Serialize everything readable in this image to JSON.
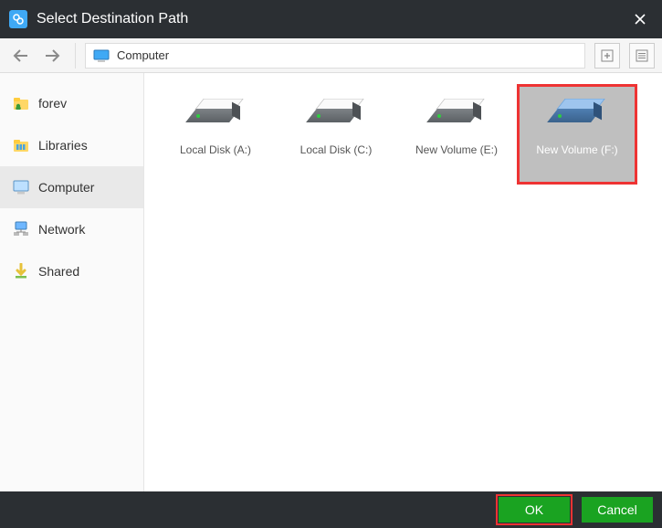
{
  "title": "Select Destination Path",
  "path_label": "Computer",
  "sidebar": {
    "items": [
      {
        "label": "forev",
        "icon": "user-folder"
      },
      {
        "label": "Libraries",
        "icon": "libraries"
      },
      {
        "label": "Computer",
        "icon": "computer",
        "active": true
      },
      {
        "label": "Network",
        "icon": "network"
      },
      {
        "label": "Shared",
        "icon": "shared"
      }
    ]
  },
  "drives": [
    {
      "label": "Local Disk (A:)",
      "selected": false,
      "color": "gray"
    },
    {
      "label": "Local Disk (C:)",
      "selected": false,
      "color": "gray"
    },
    {
      "label": "New Volume (E:)",
      "selected": false,
      "color": "gray"
    },
    {
      "label": "New Volume (F:)",
      "selected": true,
      "color": "blue"
    }
  ],
  "buttons": {
    "ok": "OK",
    "cancel": "Cancel"
  }
}
